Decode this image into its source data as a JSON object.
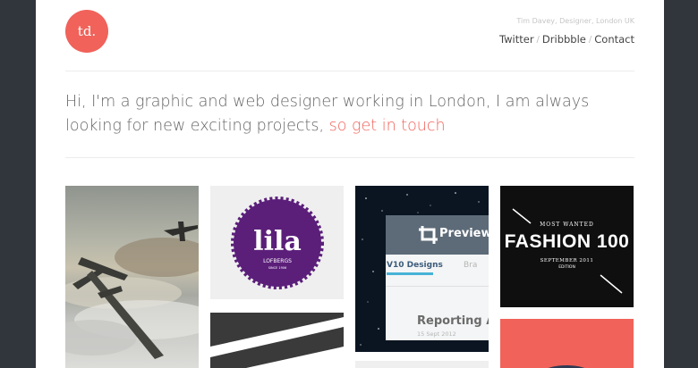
{
  "logo": {
    "text": "td."
  },
  "header": {
    "byline": "Tim Davey, Designer, London UK",
    "nav": [
      {
        "label": "Twitter"
      },
      {
        "label": "Dribbble"
      },
      {
        "label": "Contact"
      }
    ],
    "separator": "/"
  },
  "intro": {
    "text": "Hi, I'm a graphic and web designer working in London, I am always looking for new exciting projects, ",
    "cta": "so get in touch"
  },
  "portfolio": {
    "lila": {
      "word": "lila",
      "sub": "LOFBERGS",
      "since": "SINCE 1906"
    },
    "preview": {
      "title": "Preview",
      "tab_active": "V10 Designs",
      "tab_next": "Bra",
      "report_title": "Reporting Ap",
      "report_date": "15 Sept 2012"
    },
    "fashion": {
      "top": "MOST WANTED",
      "title": "FASHION 100",
      "date": "SEPTEMBER 2011",
      "edition": "EDITION"
    }
  },
  "colors": {
    "background": "#31363c",
    "accent": "#f0625a",
    "lila_purple": "#5b1f7a"
  }
}
